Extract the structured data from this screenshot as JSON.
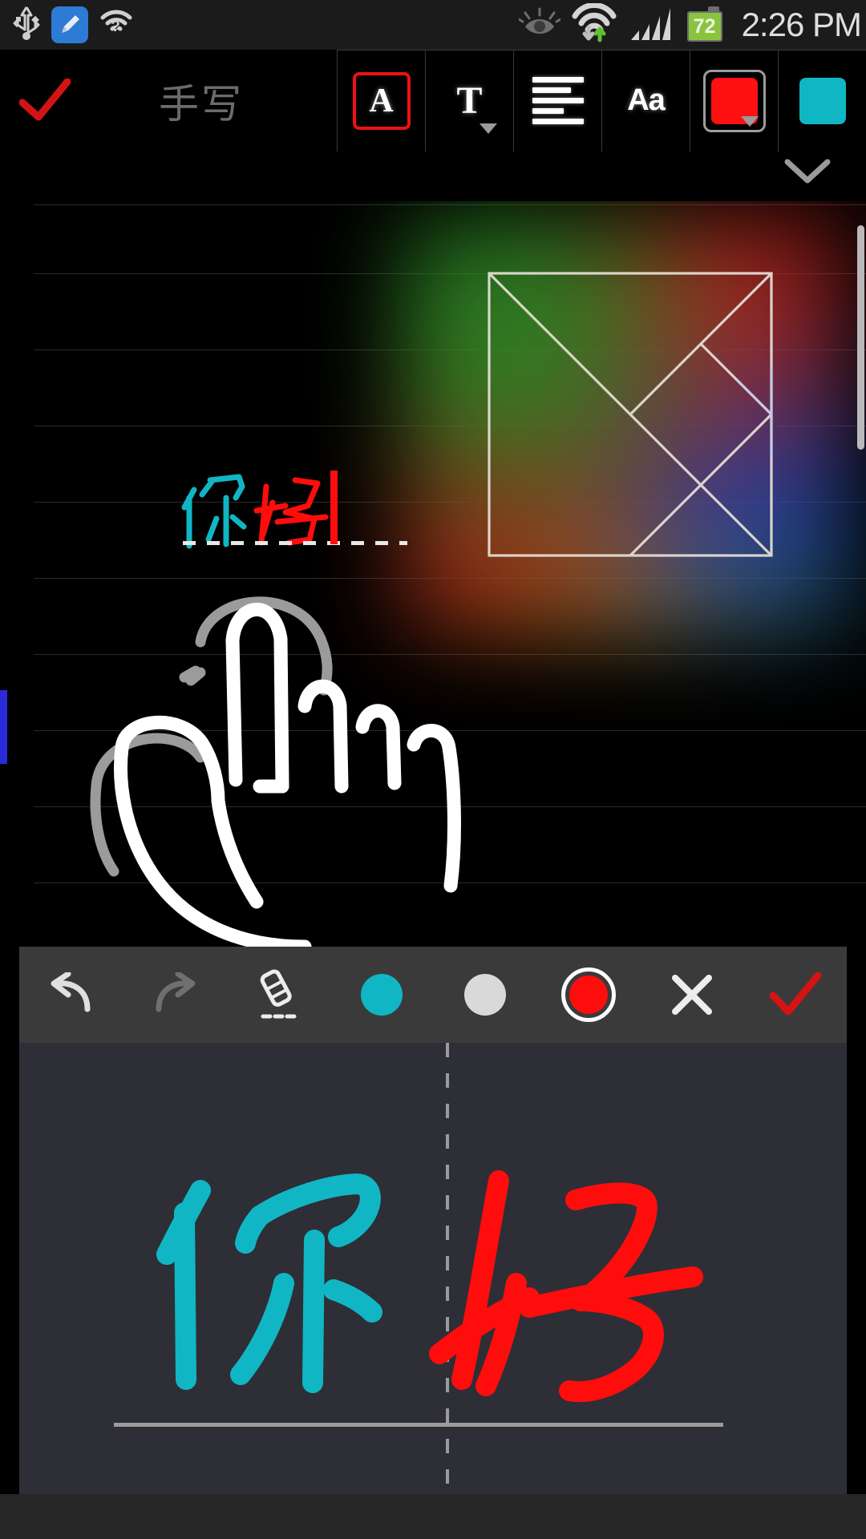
{
  "status_bar": {
    "left_icons": [
      {
        "name": "usb-icon",
        "label": "USB"
      },
      {
        "name": "cleaner-icon",
        "label": "Cleaner"
      },
      {
        "name": "wifi-question-icon",
        "label": "Wi-Fi unknown"
      }
    ],
    "right_icons": [
      {
        "name": "smart-stay-eye-icon",
        "label": "Smart stay"
      },
      {
        "name": "wifi-transfer-icon",
        "label": "Wi-Fi data transfer"
      },
      {
        "name": "signal-bars-icon",
        "label": "Signal"
      }
    ],
    "battery_percent": "72",
    "clock": "2:26 PM"
  },
  "top_bar": {
    "confirm_label": "✓",
    "title": "手写",
    "tools": [
      {
        "name": "text-style-button",
        "label": "A",
        "selected": true
      },
      {
        "name": "font-family-button",
        "label": "T",
        "has_dropdown": true,
        "selected": false
      },
      {
        "name": "paragraph-align-button",
        "label": "align",
        "selected": false
      },
      {
        "name": "font-size-button",
        "label": "Aa",
        "selected": false
      },
      {
        "name": "text-color-button",
        "label": "color",
        "color": "#ff1111",
        "selected": true
      },
      {
        "name": "highlight-color-button",
        "label": "color",
        "color": "#11b6c4",
        "selected": false
      }
    ],
    "collapse_label": "⌄"
  },
  "page": {
    "text_preview": "你好",
    "text_chars": [
      {
        "char": "你",
        "color": "#11b6c4"
      },
      {
        "char": "好",
        "color": "#ff0d0d"
      }
    ],
    "caret_color": "#ff0d0d",
    "shape_name": "tangram-square",
    "rule_line_color": "#2a2a2a"
  },
  "hw_panel": {
    "toolbar": [
      {
        "name": "undo-button",
        "label": "↶",
        "selected": false
      },
      {
        "name": "redo-button",
        "label": "↷",
        "selected": false
      },
      {
        "name": "eraser-button",
        "label": "eraser",
        "selected": false
      },
      {
        "name": "pen-color-cyan-button",
        "label": "cyan",
        "color": "#11b6c4",
        "selected": false
      },
      {
        "name": "pen-color-white-button",
        "label": "white",
        "color": "#d9d9d9",
        "selected": false
      },
      {
        "name": "pen-color-red-button",
        "label": "red",
        "color": "#ff0d0d",
        "selected": true
      },
      {
        "name": "close-button",
        "label": "✕",
        "selected": false
      },
      {
        "name": "accept-button",
        "label": "✓",
        "selected": false
      }
    ],
    "ink_chars": [
      {
        "char": "你",
        "color": "#11b6c4"
      },
      {
        "char": "好",
        "color": "#ff0d0d"
      }
    ],
    "divider_name": "character-divider",
    "baseline_name": "writing-baseline"
  },
  "colors": {
    "accent_red": "#ff0d0d",
    "accent_cyan": "#11b6c4",
    "panel_bg": "#2e2e36",
    "toolbar_bg": "#3a3a3a",
    "status_bg": "#1b1b1b",
    "battery_green": "#8ac43f"
  }
}
